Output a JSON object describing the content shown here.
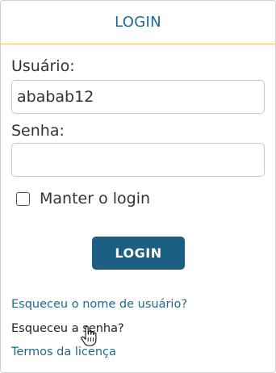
{
  "header": {
    "title": "LOGIN"
  },
  "form": {
    "username_label": "Usuário:",
    "username_value": "ababab12",
    "password_label": "Senha:",
    "password_value": "",
    "remember_label": "Manter o login",
    "remember_checked": false,
    "submit_label": "LOGIN"
  },
  "links": {
    "forgot_username": "Esqueceu o nome de usuário?",
    "forgot_password": "Esqueceu a senha?",
    "terms": "Termos da licença"
  },
  "colors": {
    "accent": "#1c5f82",
    "link": "#1f6a8a",
    "header_rule": "#e2c65e"
  },
  "icons": {
    "cursor": "hand-pointer-icon"
  }
}
